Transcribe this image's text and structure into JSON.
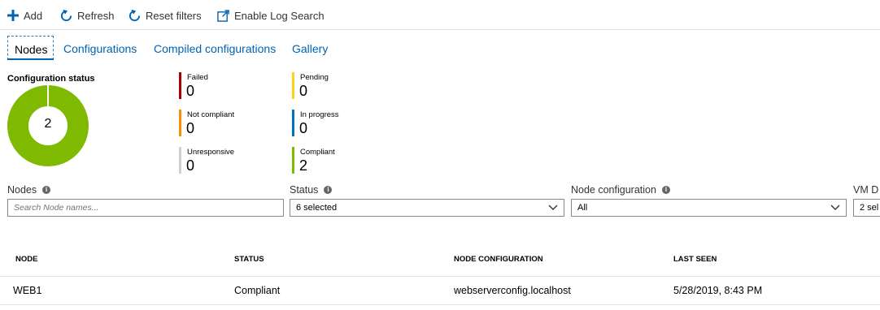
{
  "toolbar": {
    "add_label": "Add",
    "refresh_label": "Refresh",
    "reset_filters_label": "Reset filters",
    "enable_log_search_label": "Enable Log Search"
  },
  "tabs": [
    {
      "label": "Nodes",
      "active": true
    },
    {
      "label": "Configurations",
      "active": false
    },
    {
      "label": "Compiled configurations",
      "active": false
    },
    {
      "label": "Gallery",
      "active": false
    }
  ],
  "config_status": {
    "title": "Configuration status",
    "total": "2",
    "donut_color": "#7fba00",
    "stats": [
      {
        "label": "Failed",
        "value": "0",
        "color": "#a80000"
      },
      {
        "label": "Not compliant",
        "value": "0",
        "color": "#ff8c00"
      },
      {
        "label": "Unresponsive",
        "value": "0",
        "color": "#d0d0d0"
      },
      {
        "label": "Pending",
        "value": "0",
        "color": "#fcd116"
      },
      {
        "label": "In progress",
        "value": "0",
        "color": "#0072c6"
      },
      {
        "label": "Compliant",
        "value": "2",
        "color": "#7fba00"
      }
    ]
  },
  "filters": {
    "nodes": {
      "label": "Nodes",
      "placeholder": "Search Node names..."
    },
    "status": {
      "label": "Status",
      "value": "6 selected"
    },
    "node_configuration": {
      "label": "Node configuration",
      "value": "All"
    },
    "vm_d": {
      "label": "VM D",
      "value": "2 sel"
    }
  },
  "table": {
    "columns": [
      "NODE",
      "STATUS",
      "NODE CONFIGURATION",
      "LAST SEEN"
    ],
    "rows": [
      [
        "WEB1",
        "Compliant",
        "webserverconfig.localhost",
        "5/28/2019, 8:43 PM"
      ]
    ]
  }
}
